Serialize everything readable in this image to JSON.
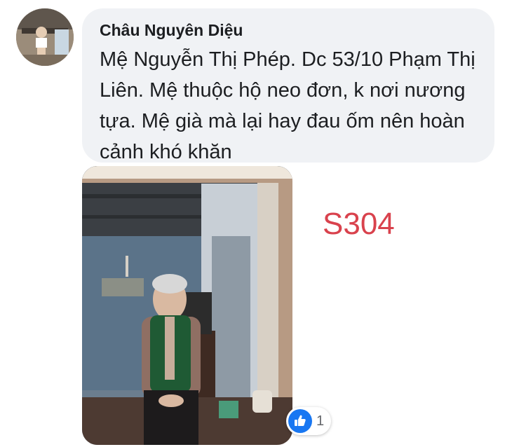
{
  "comment": {
    "author": "Châu Nguyên Diệu",
    "text": "Mệ Nguyễn Thị Phép. Dc 53/10 Phạm Thị Liên. Mệ thuộc hộ neo đơn, k nơi nương tựa. Mệ già mà lại hay đau ốm nên hoàn cảnh khó khăn",
    "avatar_icon": "profile-photo",
    "photo_icon": "attached-photo"
  },
  "overlay": {
    "code_label": "S304",
    "code_color": "#d9424d"
  },
  "reactions": {
    "icon": "like-icon",
    "count": "1",
    "color": "#1877f2"
  },
  "colors": {
    "bubble": "#f0f2f5",
    "text": "#1c1e21"
  }
}
